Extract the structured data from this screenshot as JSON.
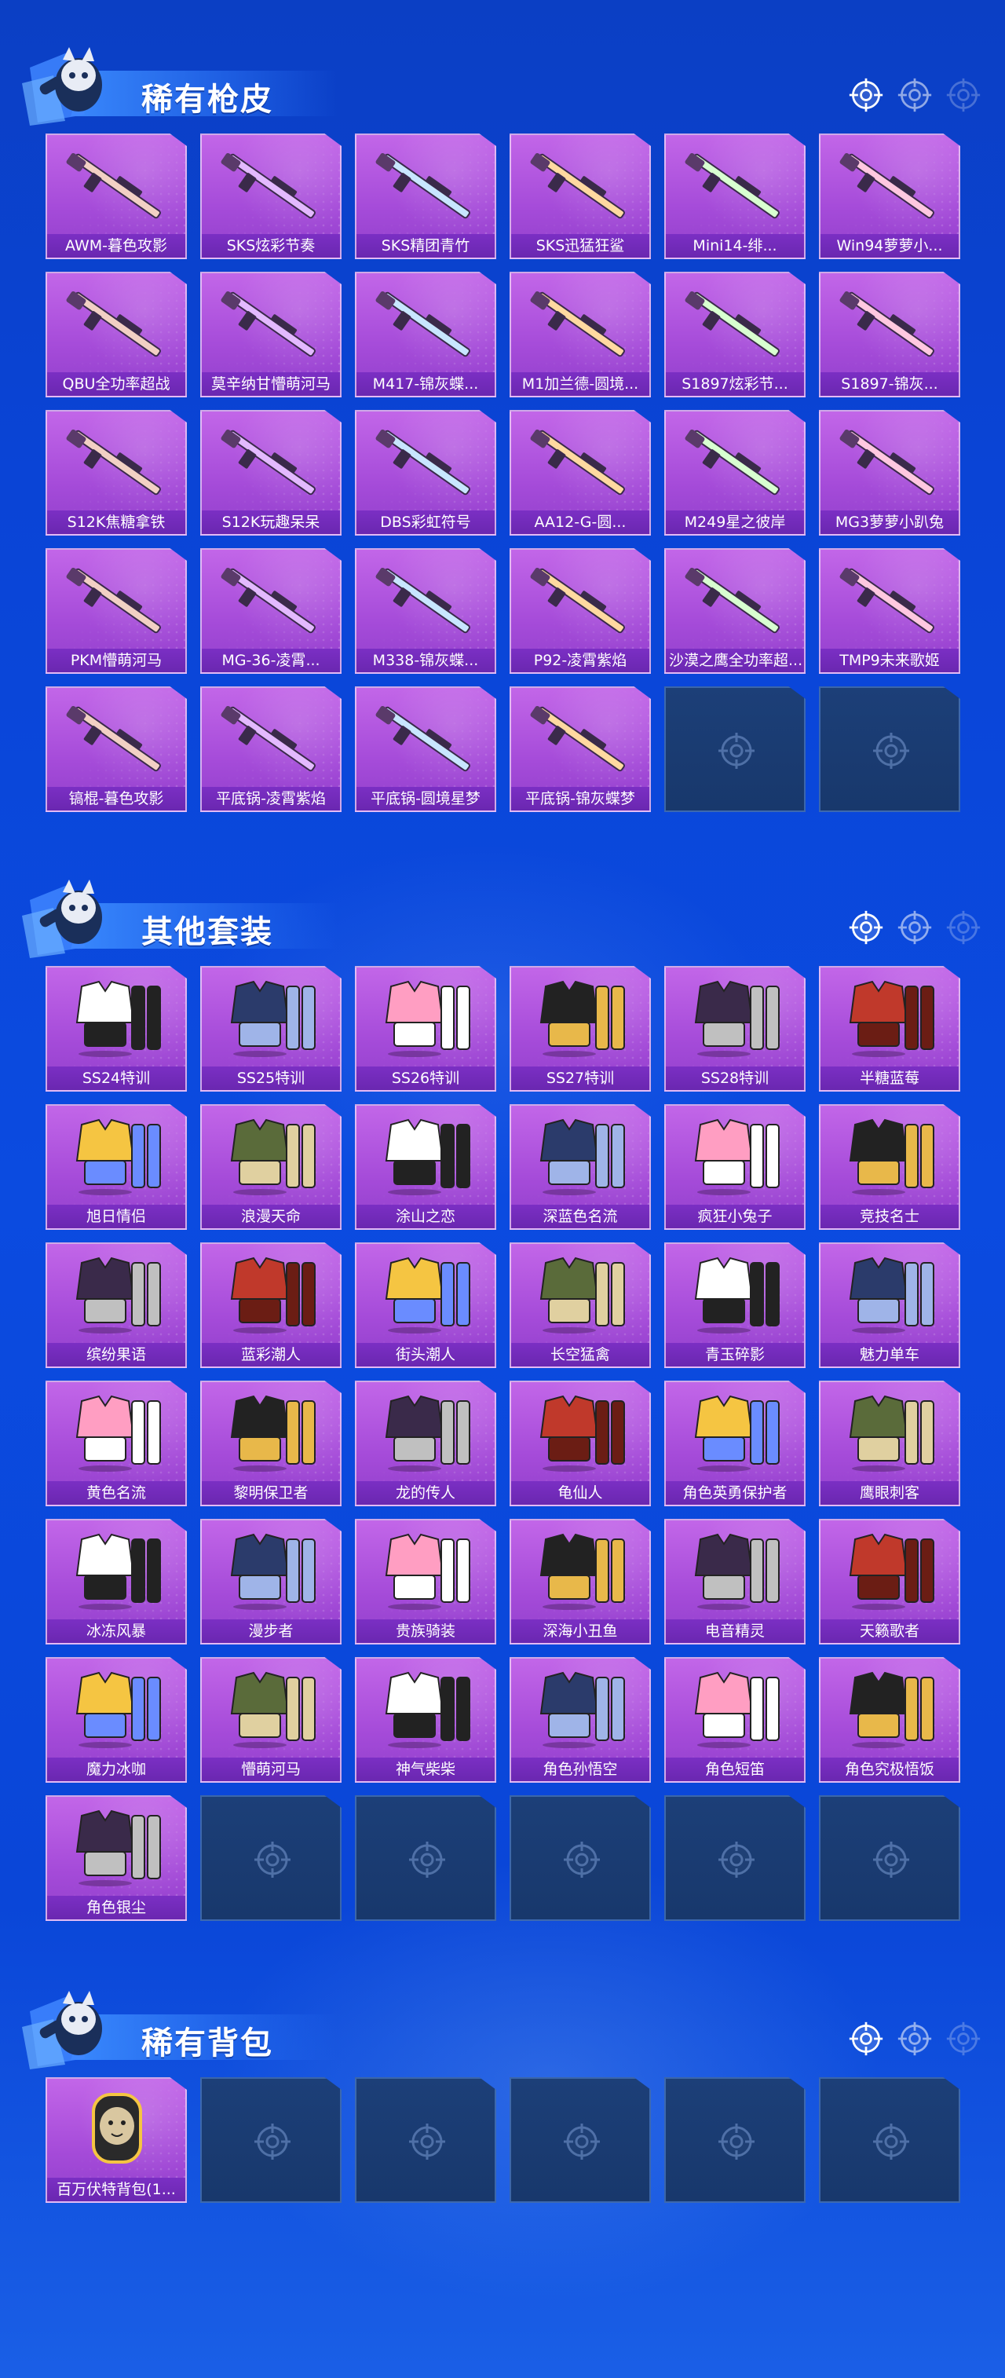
{
  "sections": [
    {
      "title": "稀有枪皮",
      "items": [
        "AWM-暮色攻影",
        "SKS炫彩节奏",
        "SKS精团青竹",
        "SKS迅猛狂鲨",
        "Mini14-绯...",
        "Win94萝萝小...",
        "QBU全功率超战",
        "莫辛纳甘懵萌河马",
        "M417-锦灰蝶...",
        "M1加兰德-圆境...",
        "S1897炫彩节...",
        "S1897-锦灰...",
        "S12K焦糖拿铁",
        "S12K玩趣呆呆",
        "DBS彩虹符号",
        "AA12-G-圆...",
        "M249星之彼岸",
        "MG3萝萝小趴兔",
        "PKM懵萌河马",
        "MG-36-凌霄...",
        "M338-锦灰蝶...",
        "P92-凌霄紫焰",
        "沙漠之鹰全功率超...",
        "TMP9未来歌姬",
        "镐棍-暮色攻影",
        "平底锅-凌霄紫焰",
        "平底锅-圆境星梦",
        "平底锅-锦灰蝶梦"
      ],
      "empty_count": 2
    },
    {
      "title": "其他套装",
      "items": [
        "SS24特训",
        "SS25特训",
        "SS26特训",
        "SS27特训",
        "SS28特训",
        "半糖蓝莓",
        "旭日情侣",
        "浪漫天命",
        "涂山之恋",
        "深蓝色名流",
        "疯狂小兔子",
        "竞技名士",
        "缤纷果语",
        "蓝彩潮人",
        "街头潮人",
        "长空猛禽",
        "青玉碎影",
        "魅力单车",
        "黄色名流",
        "黎明保卫者",
        "龙的传人",
        "龟仙人",
        "角色英勇保护者",
        "鹰眼刺客",
        "冰冻风暴",
        "漫步者",
        "贵族骑装",
        "深海小丑鱼",
        "电音精灵",
        "天籁歌者",
        "魔力冰咖",
        "懵萌河马",
        "神气柴柴",
        "角色孙悟空",
        "角色短笛",
        "角色究极悟饭",
        "角色银尘"
      ],
      "empty_count": 5
    },
    {
      "title": "稀有背包",
      "items": [
        "百万伏特背包(1..."
      ],
      "empty_count": 5
    }
  ],
  "colors": {
    "background": "#0b46d8",
    "tile_purple": "#a54bd9",
    "label_purple": "#6a27b0",
    "empty_tile": "#1c3f78"
  },
  "icons": {
    "section_header": [
      "crosshair-icon",
      "crosshair-icon",
      "crosshair-icon"
    ],
    "empty_slot": "crosshair-icon"
  }
}
